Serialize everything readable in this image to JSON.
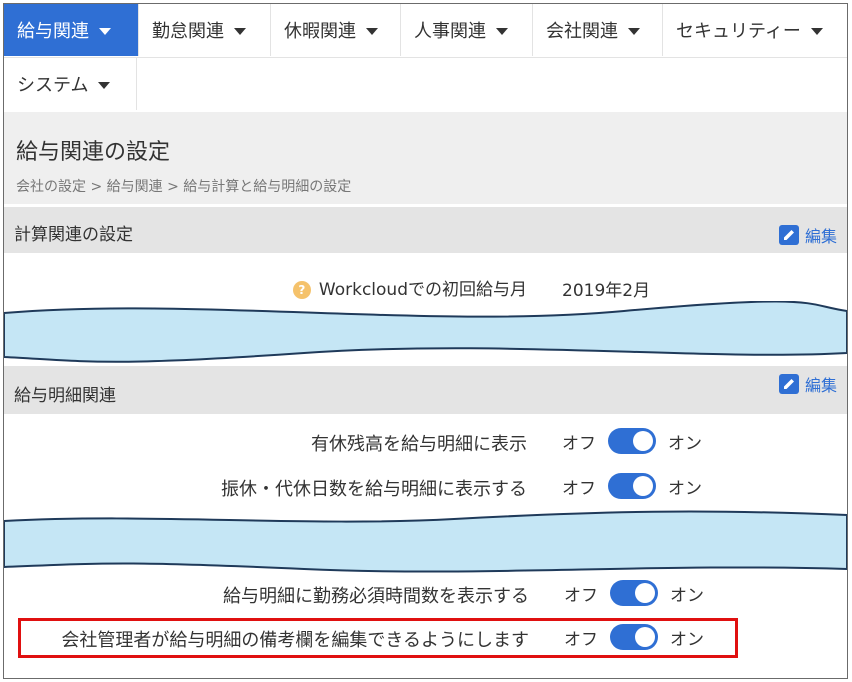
{
  "nav": {
    "tabs": [
      {
        "label": "給与関連",
        "active": true
      },
      {
        "label": "勤怠関連"
      },
      {
        "label": "休暇関連"
      },
      {
        "label": "人事関連"
      },
      {
        "label": "会社関連"
      },
      {
        "label": "セキュリティー"
      },
      {
        "label": "システム"
      }
    ]
  },
  "header": {
    "title": "給与関連の設定",
    "breadcrumb": "会社の設定 > 給与関連 > 給与計算と給与明細の設定"
  },
  "sections": {
    "calc": {
      "title": "計算関連の設定",
      "edit_label": "編集",
      "rows": [
        {
          "label": "Workcloudでの初回給与月",
          "value": "2019年2月",
          "help": "?"
        }
      ]
    },
    "payslip": {
      "title": "給与明細関連",
      "edit_label": "編集",
      "rows": [
        {
          "label": "有休残高を給与明細に表示",
          "off": "オフ",
          "on": "オン",
          "state": "on"
        },
        {
          "label": "振休・代休日数を給与明細に表示する",
          "off": "オフ",
          "on": "オン",
          "state": "on"
        },
        {
          "label": "給与明細に勤務必須時間数を表示する",
          "off": "オフ",
          "on": "オン",
          "state": "on"
        },
        {
          "label": "会社管理者が給与明細の備考欄を編集できるようにします",
          "off": "オフ",
          "on": "オン",
          "state": "on"
        }
      ]
    }
  },
  "colors": {
    "accent": "#2f6fd4",
    "highlight": "#e01010",
    "cut_band": "#c5e6f5"
  }
}
